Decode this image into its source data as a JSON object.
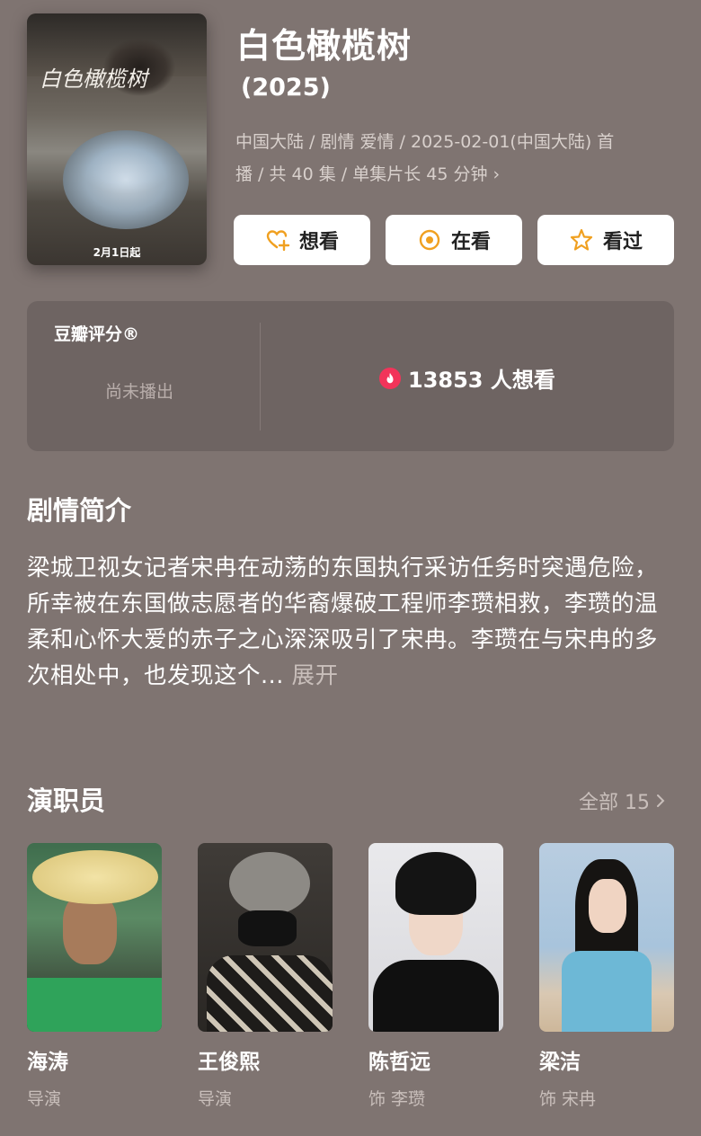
{
  "movie": {
    "title": "白色橄榄树",
    "year": "(2025)",
    "meta_line1": "中国大陆 / 剧情 爱情 / 2025-02-01(中国大陆) 首",
    "meta_line2": "播 / 共 40 集 / 单集片长 45 分钟",
    "meta_chevron": "›",
    "poster_title": "白色橄榄树",
    "poster_date": "2月1日起"
  },
  "actions": {
    "want": "想看",
    "watching": "在看",
    "watched": "看过"
  },
  "rating": {
    "label": "豆瓣评分®",
    "status": "尚未播出",
    "want_count": "13853 人想看"
  },
  "synopsis": {
    "title": "剧情简介",
    "text": "梁城卫视女记者宋冉在动荡的东国执行采访任务时突遇危险，所幸被在东国做志愿者的华裔爆破工程师李瓒相救，李瓒的温柔和心怀大爱的赤子之心深深吸引了宋冉。李瓒在与宋冉的多次相处中，也发现这个...",
    "more": "展开"
  },
  "cast": {
    "title": "演职员",
    "all_label": "全部 15",
    "members": [
      {
        "name": "海涛",
        "role": "导演"
      },
      {
        "name": "王俊熙",
        "role": "导演"
      },
      {
        "name": "陈哲远",
        "role": "饰 李瓒"
      },
      {
        "name": "梁洁",
        "role": "饰 宋冉"
      }
    ]
  },
  "colors": {
    "background": "#7f7471",
    "card": "#6e6462",
    "accent_orange": "#f0a020",
    "fire_red": "#f2345a"
  }
}
